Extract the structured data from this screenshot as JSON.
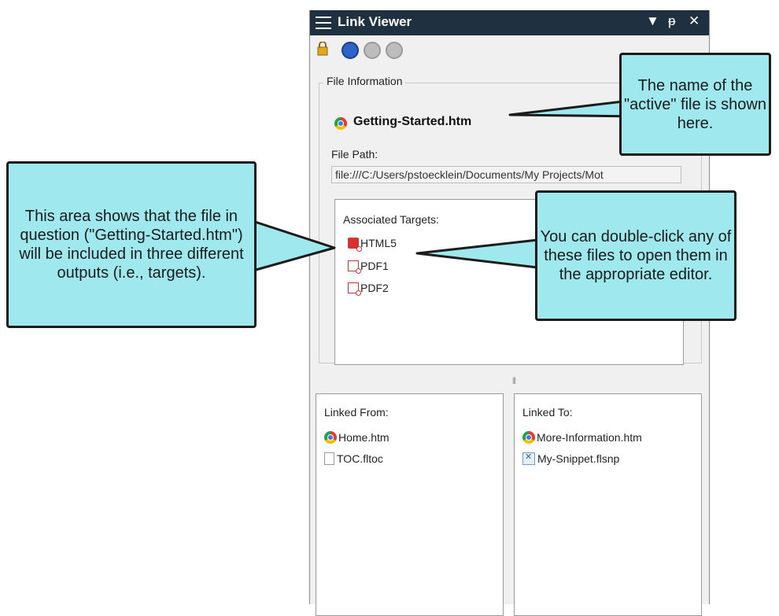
{
  "panel": {
    "title": "Link Viewer",
    "pin_glyph": "▾ ᵖ ✕"
  },
  "toolbar": {
    "icons": [
      "lock-icon",
      "refresh-icon",
      "back-icon",
      "forward-icon"
    ]
  },
  "file_info": {
    "section_label": "File Information",
    "file_name": "Getting-Started.htm",
    "path_label": "File Path:",
    "path_value": "file:///C:/Users/pstoecklein/Documents/My Projects/Mot"
  },
  "targets": {
    "label": "Associated Targets:",
    "items": [
      "HTML5",
      "PDF1",
      "PDF2"
    ]
  },
  "linked_from": {
    "label": "Linked From:",
    "items": [
      "Home.htm",
      "TOC.fltoc"
    ]
  },
  "linked_to": {
    "label": "Linked To:",
    "items": [
      "More-Information.htm",
      "My-Snippet.flsnp"
    ]
  },
  "callouts": {
    "active_file": "The name of the \"active\" file is shown here.",
    "targets_area": "This area shows that the file in question (\"Getting-Started.htm\") will be included in three different outputs (i.e., targets).",
    "double_click": "You can double-click any of these files to open them in the appropriate editor."
  },
  "colors": {
    "titlebar": "#1f3141",
    "callout_fill": "#9ee8ee"
  }
}
